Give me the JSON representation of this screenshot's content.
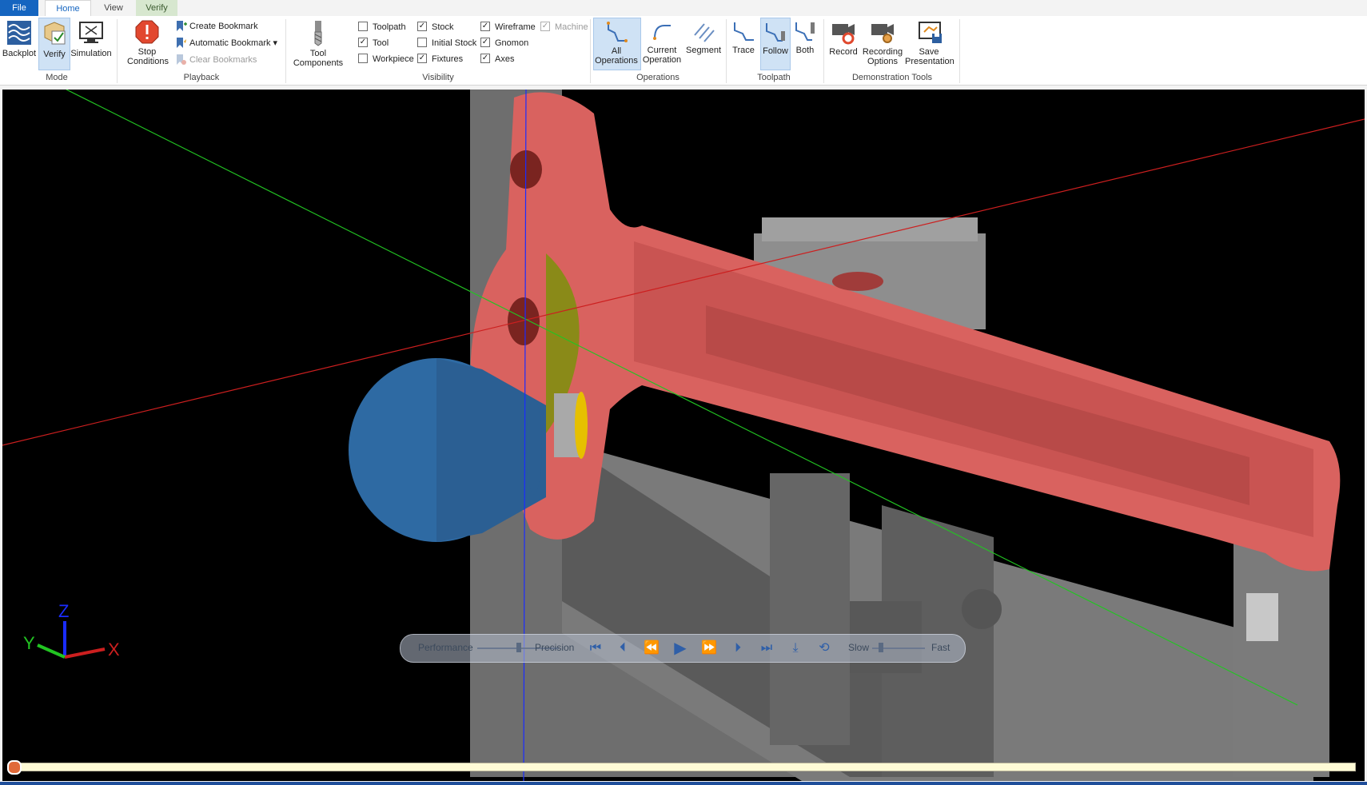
{
  "tabs": {
    "file": "File",
    "home": "Home",
    "view": "View",
    "verify": "Verify"
  },
  "mode": {
    "backplot": "Backplot",
    "verify": "Verify",
    "simulation": "Simulation",
    "group": "Mode"
  },
  "playback": {
    "stop_conditions": "Stop Conditions",
    "create_bookmark": "Create Bookmark",
    "automatic_bookmark": "Automatic Bookmark",
    "clear_bookmarks": "Clear Bookmarks",
    "group": "Playback"
  },
  "tool_components": {
    "label": "Tool Components",
    "group": "Visibility"
  },
  "visibility": {
    "toolpath": "Toolpath",
    "tool": "Tool",
    "workpiece": "Workpiece",
    "stock": "Stock",
    "initial_stock": "Initial Stock",
    "fixtures": "Fixtures",
    "wireframe": "Wireframe",
    "gnomon": "Gnomon",
    "axes": "Axes",
    "machine": "Machine",
    "checked_mark": "✓"
  },
  "operations": {
    "all": "All Operations",
    "current": "Current Operation",
    "segment": "Segment",
    "group": "Operations"
  },
  "toolpath": {
    "trace": "Trace",
    "follow": "Follow",
    "both": "Both",
    "group": "Toolpath"
  },
  "demo": {
    "record": "Record",
    "recording_options": "Recording Options",
    "save_presentation": "Save Presentation",
    "group": "Demonstration Tools"
  },
  "gnomon": {
    "x": "X",
    "y": "Y",
    "z": "Z"
  },
  "playbar": {
    "performance": "Performance",
    "precision": "Precision",
    "slow": "Slow",
    "fast": "Fast"
  },
  "colors": {
    "part": "#d9625f",
    "tool_holder": "#2e6aa3",
    "fixture": "#8a8a8a",
    "axis_x": "#cc1f1f",
    "axis_y": "#22c422",
    "axis_z": "#1a2cff",
    "accent": "#1565c0"
  },
  "icons": [
    "backplot-icon",
    "verify-icon",
    "simulation-icon",
    "stop-icon",
    "bookmark-icon",
    "tool-icon",
    "operations-icon",
    "trace-icon",
    "follow-icon",
    "both-icon",
    "record-icon",
    "recording-options-icon",
    "save-presentation-icon"
  ]
}
